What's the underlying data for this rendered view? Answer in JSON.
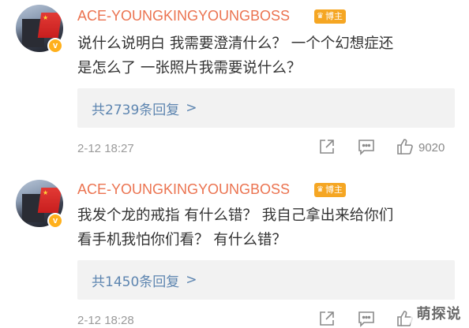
{
  "comments": [
    {
      "username": "ACE-YOUNGKINGYOUNGBOSS",
      "role_badge": "博主",
      "verified_mark": "v",
      "text_line1": "说什么说明白 我需要澄清什么？ 一个个幻想症还",
      "text_line2": "是怎么了 一张照片我需要说什么？",
      "replies_label": "共2739条回复",
      "replies_chevron": ">",
      "timestamp": "2-12 18:27",
      "likes": "9020",
      "icons": {
        "share": "share-icon",
        "comment": "comment-icon",
        "like": "thumbs-up-icon"
      }
    },
    {
      "username": "ACE-YOUNGKINGYOUNGBOSS",
      "role_badge": "博主",
      "verified_mark": "v",
      "text_line1": "我发个龙的戒指 有什么错？ 我自己拿出来给你们",
      "text_line2": "看手机我怕你们看？ 有什么错？",
      "replies_label": "共1450条回复",
      "replies_chevron": ">",
      "timestamp": "2-12 18:28",
      "icons": {
        "share": "share-icon",
        "comment": "comment-icon",
        "like": "thumbs-up-icon"
      }
    }
  ],
  "watermark": "萌探说",
  "colors": {
    "username": "#eb7350",
    "badge": "#f5a623",
    "link": "#5d85b0",
    "meta": "#9a9a9a",
    "reply_bg": "#f2f2f2"
  }
}
